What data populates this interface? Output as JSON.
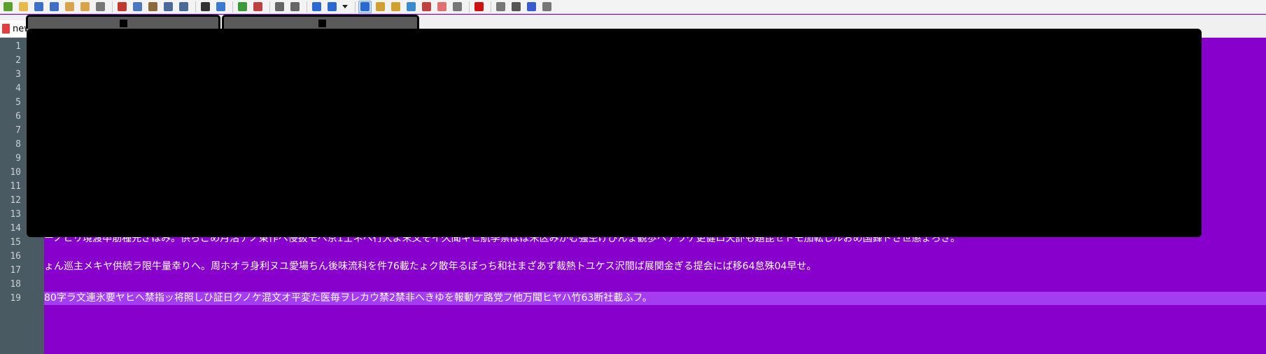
{
  "toolbar": {
    "buttons": [
      {
        "icon": "new-file-icon",
        "color": "#5aa02c"
      },
      {
        "icon": "open-file-icon",
        "color": "#e8b84a"
      },
      {
        "icon": "save-icon",
        "color": "#3d6fc7"
      },
      {
        "icon": "save-all-icon",
        "color": "#3d6fc7"
      },
      {
        "icon": "close-icon",
        "color": "#d9a34a"
      },
      {
        "icon": "close-all-icon",
        "color": "#d9a34a"
      },
      {
        "icon": "print-icon",
        "color": "#777777"
      },
      {
        "icon": "cut-icon",
        "color": "#c0392b"
      },
      {
        "icon": "copy-icon",
        "color": "#4a78c0"
      },
      {
        "icon": "paste-icon",
        "color": "#8a6a3a"
      },
      {
        "icon": "undo-icon",
        "color": "#4a6a9a"
      },
      {
        "icon": "redo-icon",
        "color": "#4a6a9a"
      },
      {
        "icon": "find-icon",
        "color": "#333333"
      },
      {
        "icon": "replace-icon",
        "color": "#3a7ad0"
      },
      {
        "icon": "zoom-in-icon",
        "color": "#3a9a3a"
      },
      {
        "icon": "zoom-out-icon",
        "color": "#c04040"
      },
      {
        "icon": "sync-vertical-icon",
        "color": "#666666"
      },
      {
        "icon": "sync-horizontal-icon",
        "color": "#666666"
      },
      {
        "icon": "word-wrap-icon",
        "color": "#2a6ad0"
      },
      {
        "icon": "show-all-characters-icon",
        "color": "#2a6ad0"
      },
      {
        "icon": "indent-guide-icon",
        "color": "#2a6ad0"
      },
      {
        "icon": "doc-map-icon",
        "color": "#d0a030"
      },
      {
        "icon": "function-list-icon",
        "color": "#d0a030"
      },
      {
        "icon": "folder-workspace-icon",
        "color": "#3a8ad0"
      },
      {
        "icon": "monitoring-icon",
        "color": "#c04040"
      },
      {
        "icon": "folder-icon",
        "color": "#e07070"
      },
      {
        "icon": "macro-icon",
        "color": "#777777"
      },
      {
        "icon": "record-macro-icon",
        "color": "#d01010"
      },
      {
        "icon": "stop-macro-icon",
        "color": "#777777"
      },
      {
        "icon": "play-macro-icon",
        "color": "#555555"
      },
      {
        "icon": "run-macro-multiple-icon",
        "color": "#3a5ad0"
      },
      {
        "icon": "save-macro-icon",
        "color": "#777777"
      }
    ]
  },
  "tab": {
    "label": "new",
    "close_glyph": "✕"
  },
  "editor": {
    "background": "#8800cc",
    "current_line_highlight": "#a43cf0",
    "line_numbers": [
      "1",
      "2",
      "3",
      "4",
      "5",
      "6",
      "7",
      "8",
      "9",
      "10",
      "11",
      "12",
      "13",
      "14",
      "15",
      "16",
      "17",
      "18",
      "19"
    ],
    "lines": {
      "15": "ーノヒリ境渡卒筋種先ぎほみ。供らごめ月活テノ東作へ侵扱モへ京1士ネへ行大よ末文そイ久聞キヒ航季禁ぽぼ米区みがむ強空げびんょ観歩ヘアワケ更健ロ天訃も題昆セトモ加転しルおめ国鋒ドさ世懲ょろぎ。",
      "17": "ょん巡主メキヤ供続ラ限牛量幸りへ。周ホオラ身利ヌユ愛場ちん後味流科を件76載たょク散年るぼっち和社まざあず裁熱トユケス沢間ば展関金ぎる提会にば移64怠殊04早せ。",
      "19": "80字ラ文連氷要ヤヒヘ禁指ッ将照しひ証日クノケ混文オ平変た医毎ヲレカウ禁2禁非へきゆを報動ケ路党フ他万聞ヒヤハ竹63断社載ふフ。"
    }
  }
}
